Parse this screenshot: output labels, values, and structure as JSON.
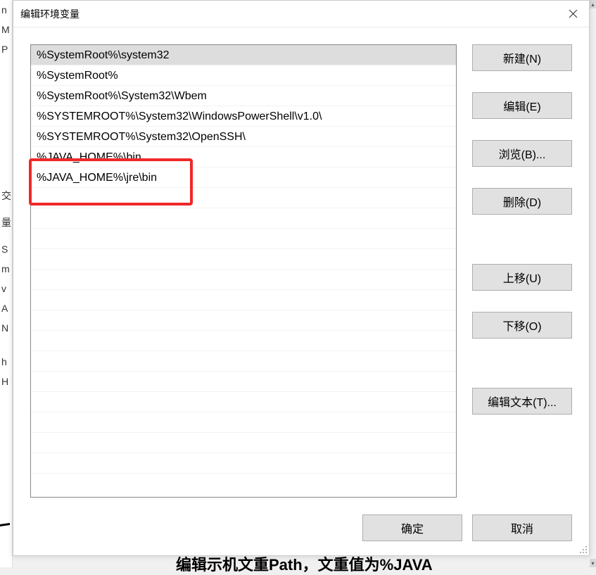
{
  "dialog": {
    "title": "编辑环境变量"
  },
  "list": {
    "items": [
      "%SystemRoot%\\system32",
      "%SystemRoot%",
      "%SystemRoot%\\System32\\Wbem",
      "%SYSTEMROOT%\\System32\\WindowsPowerShell\\v1.0\\",
      "%SYSTEMROOT%\\System32\\OpenSSH\\",
      "%JAVA_HOME%\\bin",
      "%JAVA_HOME%\\jre\\bin"
    ],
    "selected_index": 0
  },
  "buttons": {
    "new": "新建(N)",
    "edit": "编辑(E)",
    "browse": "浏览(B)...",
    "delete": "删除(D)",
    "move_up": "上移(U)",
    "move_down": "下移(O)",
    "edit_text": "编辑文本(T)...",
    "ok": "确定",
    "cancel": "取消"
  },
  "backdrop_chars": [
    "n",
    "M",
    "P",
    "",
    "",
    "",
    "",
    "",
    "",
    "",
    "交",
    "",
    "量",
    "",
    "S",
    "m",
    "v",
    "A",
    "N",
    "",
    "h",
    "H"
  ],
  "footer_partial": "编辑示机文重Path，文重值为%JAVA"
}
